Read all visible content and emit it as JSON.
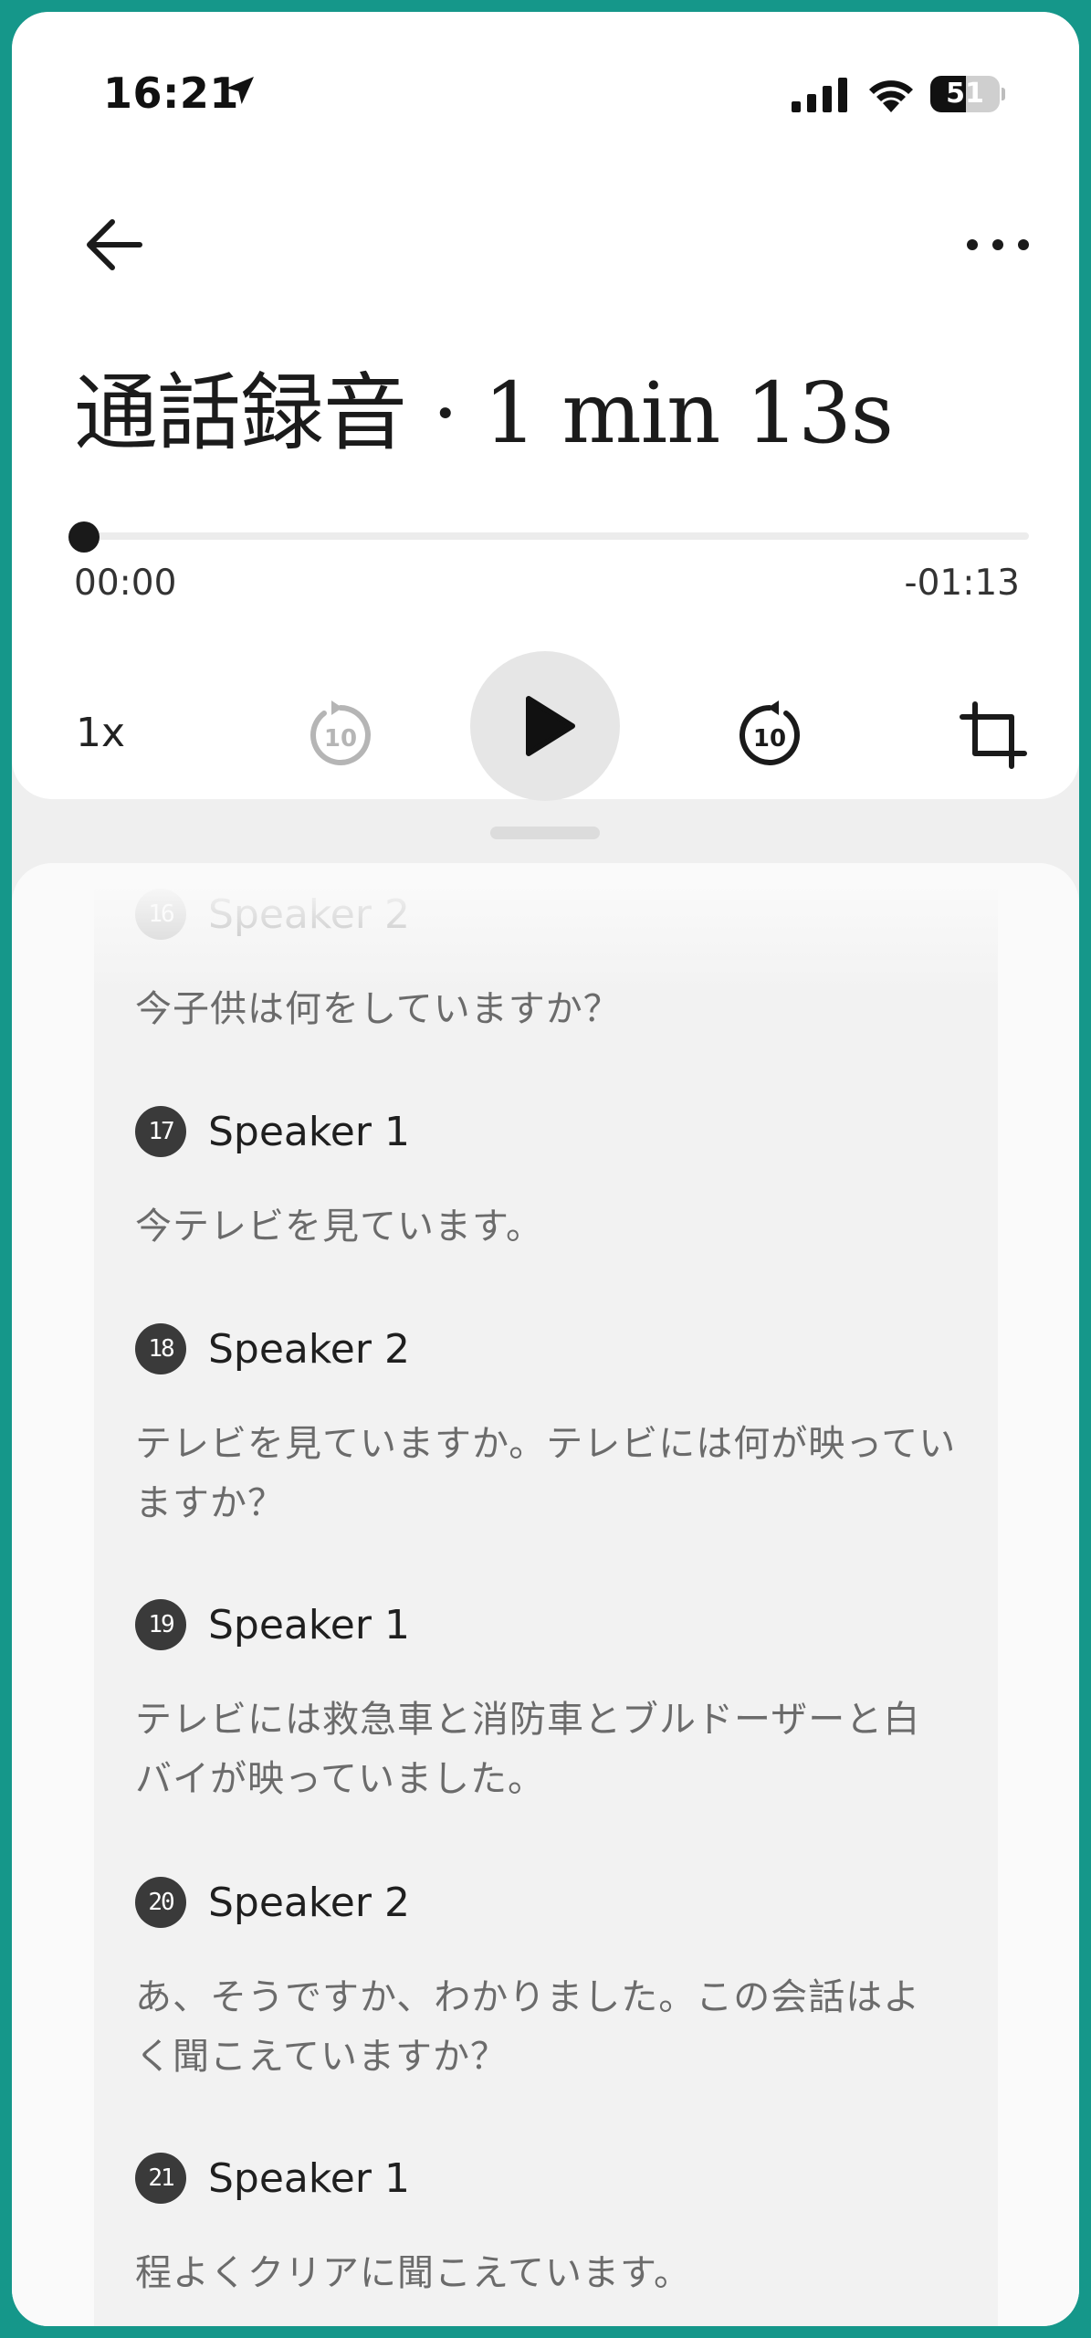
{
  "status_bar": {
    "time": "16:21",
    "battery": "51",
    "battery_level_percent": 51
  },
  "header": {
    "title": "通話録音 · 1 min 13s"
  },
  "player": {
    "elapsed": "00:00",
    "remaining": "-01:13",
    "progress_percent": 0,
    "speed": "1x",
    "skip_back_seconds": "10",
    "skip_forward_seconds": "10"
  },
  "transcript": {
    "entries": [
      {
        "num": "16",
        "speaker": "Speaker 2",
        "text": "今子供は何をしていますか？"
      },
      {
        "num": "17",
        "speaker": "Speaker 1",
        "text": "今テレビを見ています。"
      },
      {
        "num": "18",
        "speaker": "Speaker 2",
        "text": "テレビを見ていますか。テレビには何が映っていますか？"
      },
      {
        "num": "19",
        "speaker": "Speaker 1",
        "text": "テレビには救急車と消防車とブルドーザーと白バイが映っていました。"
      },
      {
        "num": "20",
        "speaker": "Speaker 2",
        "text": "あ、そうですか、わかりました。この会話はよく聞こえていますか？"
      },
      {
        "num": "21",
        "speaker": "Speaker 1",
        "text": "程よくクリアに聞こえています。"
      }
    ]
  },
  "colors": {
    "frame_border": "#15978a",
    "accent": "#1a1a1a",
    "badge": "#3a3a3a"
  }
}
